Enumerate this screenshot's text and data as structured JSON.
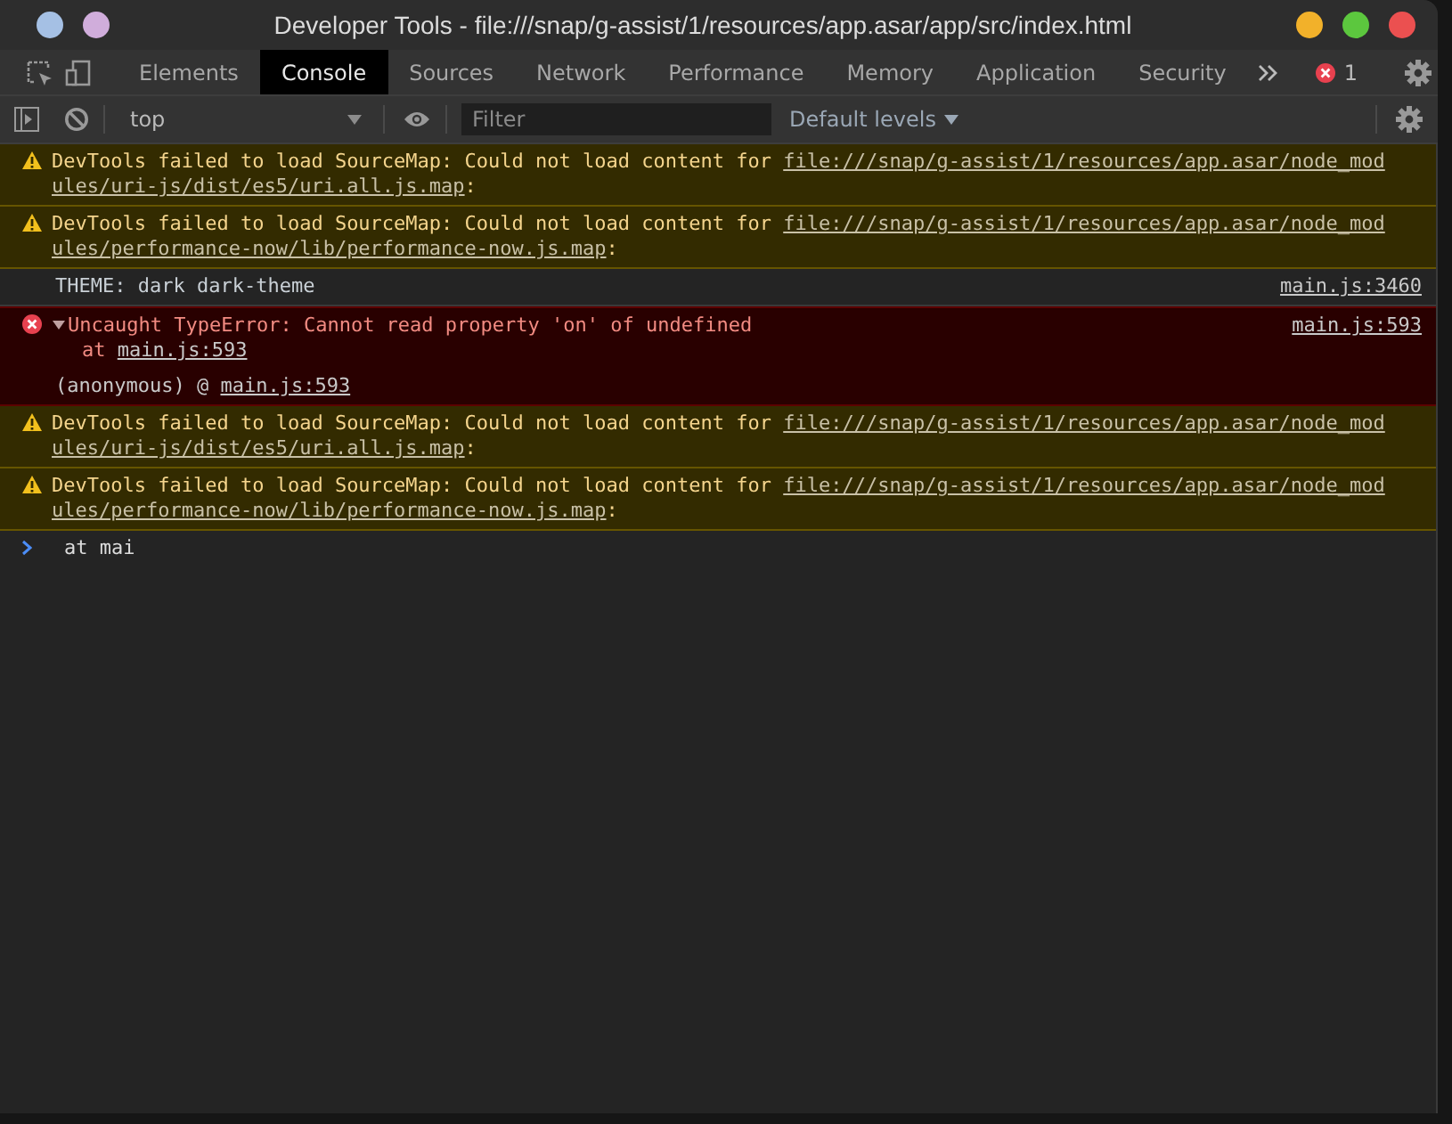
{
  "window": {
    "title": "Developer Tools - file:///snap/g-assist/1/resources/app.asar/app/src/index.html"
  },
  "tabs": [
    {
      "label": "Elements",
      "selected": false
    },
    {
      "label": "Console",
      "selected": true
    },
    {
      "label": "Sources",
      "selected": false
    },
    {
      "label": "Network",
      "selected": false
    },
    {
      "label": "Performance",
      "selected": false
    },
    {
      "label": "Memory",
      "selected": false
    },
    {
      "label": "Application",
      "selected": false
    },
    {
      "label": "Security",
      "selected": false
    }
  ],
  "error_count": "1",
  "toolbar": {
    "context": "top",
    "filter": {
      "placeholder": "Filter"
    },
    "levels": "Default levels"
  },
  "messages": [
    {
      "kind": "warning",
      "text": "DevTools failed to load SourceMap: Could not load content for ",
      "link_lines": [
        "file:///snap/g-assist/1/resources/app.asar/node_mod",
        "ules/uri-js/dist/es5/uri.all.js.map"
      ],
      "suffix": ":"
    },
    {
      "kind": "warning",
      "text": "DevTools failed to load SourceMap: Could not load content for ",
      "link_lines": [
        "file:///snap/g-assist/1/resources/app.asar/node_mod",
        "ules/performance-now/lib/performance-now.js.map"
      ],
      "suffix": ":"
    },
    {
      "kind": "info",
      "text": "THEME: dark dark-theme",
      "source": "main.js:3460"
    },
    {
      "kind": "error",
      "expanded": true,
      "text": "Uncaught TypeError: Cannot read property 'on' of undefined",
      "stack_prefix": "at ",
      "stack_link": "main.js:593",
      "source": "main.js:593",
      "trace": [
        {
          "function": "(anonymous)",
          "separator": "@",
          "link": "main.js:593"
        }
      ]
    },
    {
      "kind": "warning",
      "text": "DevTools failed to load SourceMap: Could not load content for ",
      "link_lines": [
        "file:///snap/g-assist/1/resources/app.asar/node_mod",
        "ules/uri-js/dist/es5/uri.all.js.map"
      ],
      "suffix": ":"
    },
    {
      "kind": "warning",
      "text": "DevTools failed to load SourceMap: Could not load content for ",
      "link_lines": [
        "file:///snap/g-assist/1/resources/app.asar/node_mod",
        "ules/performance-now/lib/performance-now.js.map"
      ],
      "suffix": ":"
    }
  ],
  "prompt": {
    "value": "at mai"
  }
}
